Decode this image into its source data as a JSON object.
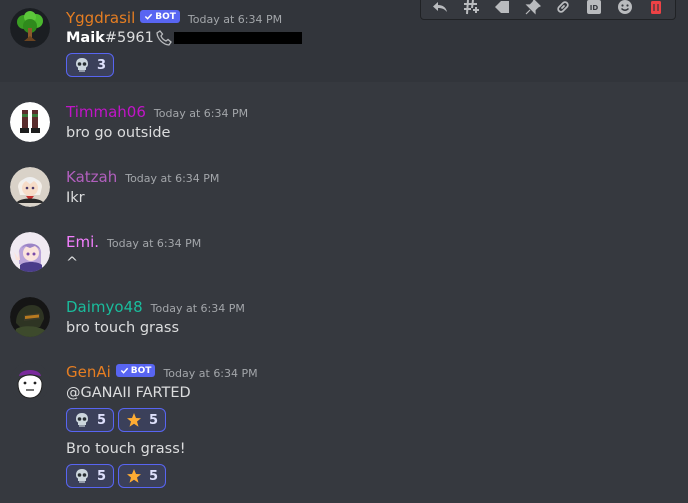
{
  "toolbar": {
    "icons": [
      "reply-icon",
      "create-thread-icon",
      "mark-unread-icon",
      "pin-icon",
      "copy-link-icon",
      "copy-id-icon",
      "add-reaction-icon",
      "delete-icon"
    ],
    "copy_id_label": "ID"
  },
  "messages": [
    {
      "username": "Yggdrasil",
      "username_color": "#e67e22",
      "bot_label": "BOT",
      "timestamp": "Today at 6:34 PM",
      "text_bold": "Maik",
      "text_rest": "#5961",
      "reactions": [
        {
          "emoji": "skull",
          "count": "3"
        }
      ]
    },
    {
      "username": "Timmah06",
      "username_color": "#c115c8",
      "timestamp": "Today at 6:34 PM",
      "text": "bro go outside"
    },
    {
      "username": "Katzah",
      "username_color": "#b15fbd",
      "timestamp": "Today at 6:34 PM",
      "text": "Ikr"
    },
    {
      "username": "Emi.",
      "username_color": "#f47fff",
      "timestamp": "Today at 6:34 PM",
      "text": "^"
    },
    {
      "username": "Daimyo48",
      "username_color": "#1abc9c",
      "timestamp": "Today at 6:34 PM",
      "text": "bro touch grass"
    },
    {
      "username": "GenAi",
      "username_color": "#e67e22",
      "bot_label": "BOT",
      "timestamp": "Today at 6:34 PM",
      "text": "@GANAII FARTED",
      "reactions": [
        {
          "emoji": "skull",
          "count": "5"
        },
        {
          "emoji": "star",
          "count": "5"
        }
      ],
      "text2": "Bro touch grass!",
      "reactions2": [
        {
          "emoji": "skull",
          "count": "5"
        },
        {
          "emoji": "star",
          "count": "5"
        }
      ]
    }
  ]
}
